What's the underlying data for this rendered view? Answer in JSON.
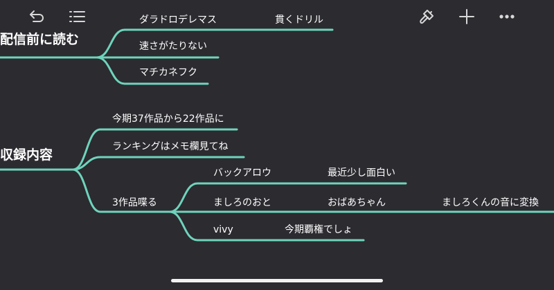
{
  "colors": {
    "background": "#2c2b30",
    "branch": "#6ed4bc",
    "text": "#ffffff",
    "icon": "#d8d8d8"
  },
  "toolbar": {
    "left_icons": [
      "undo-icon",
      "outline-list-icon"
    ],
    "right_icons": [
      "paintbrush-icon",
      "plus-icon",
      "more-icon"
    ]
  },
  "mindmap": {
    "roots": [
      {
        "label": "配信前に読む",
        "children": [
          {
            "label": "ダラドロデレマス",
            "children": [
              {
                "label": "貫くドリル"
              }
            ]
          },
          {
            "label": "速さがたりない"
          },
          {
            "label": "マチカネフク"
          }
        ]
      },
      {
        "label": "収録内容",
        "children": [
          {
            "label": "今期37作品から22作品に"
          },
          {
            "label": "ランキングはメモ欄見てね"
          },
          {
            "label": "3作品喋る",
            "children": [
              {
                "label": "バックアロウ",
                "children": [
                  {
                    "label": "最近少し面白い"
                  }
                ]
              },
              {
                "label": "ましろのおと",
                "children": [
                  {
                    "label": "おばあちゃん",
                    "children": [
                      {
                        "label": "ましろくんの音に変換"
                      }
                    ]
                  }
                ]
              },
              {
                "label": "vivy",
                "children": [
                  {
                    "label": "今期覇権でしょ"
                  }
                ]
              }
            ]
          }
        ]
      }
    ]
  }
}
